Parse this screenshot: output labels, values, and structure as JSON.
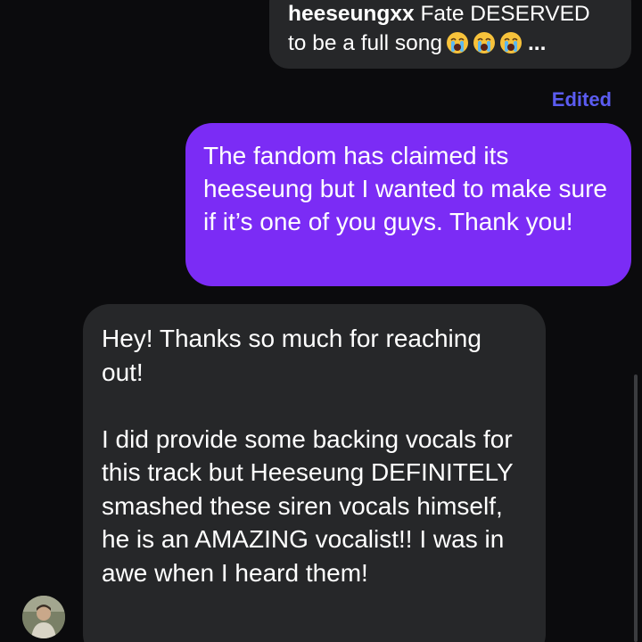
{
  "messages": {
    "story_reply": {
      "username": "heeseungxx",
      "text_line1": "Fate DESERVED",
      "text_line2": "to be a full song",
      "emojis": [
        "loudly-crying-face-emoji",
        "loudly-crying-face-emoji",
        "loudly-crying-face-emoji"
      ],
      "truncation": "..."
    },
    "edited_label": "Edited",
    "sent": {
      "text": "The fandom has claimed its heeseung but I wanted to make sure if it’s one of you guys. Thank you!",
      "color": "#7b2cf5"
    },
    "received": {
      "paragraph1": "Hey! Thanks so much for reaching out!",
      "paragraph2": "I did provide some backing vocals for this track but Heeseung DEFINITELY smashed these siren vocals himself, he is an AMAZING vocalist!! I was in awe when I heard them!",
      "color": "#262729"
    }
  },
  "colors": {
    "background": "#0b0b0d",
    "edited": "#5b5cf1"
  }
}
